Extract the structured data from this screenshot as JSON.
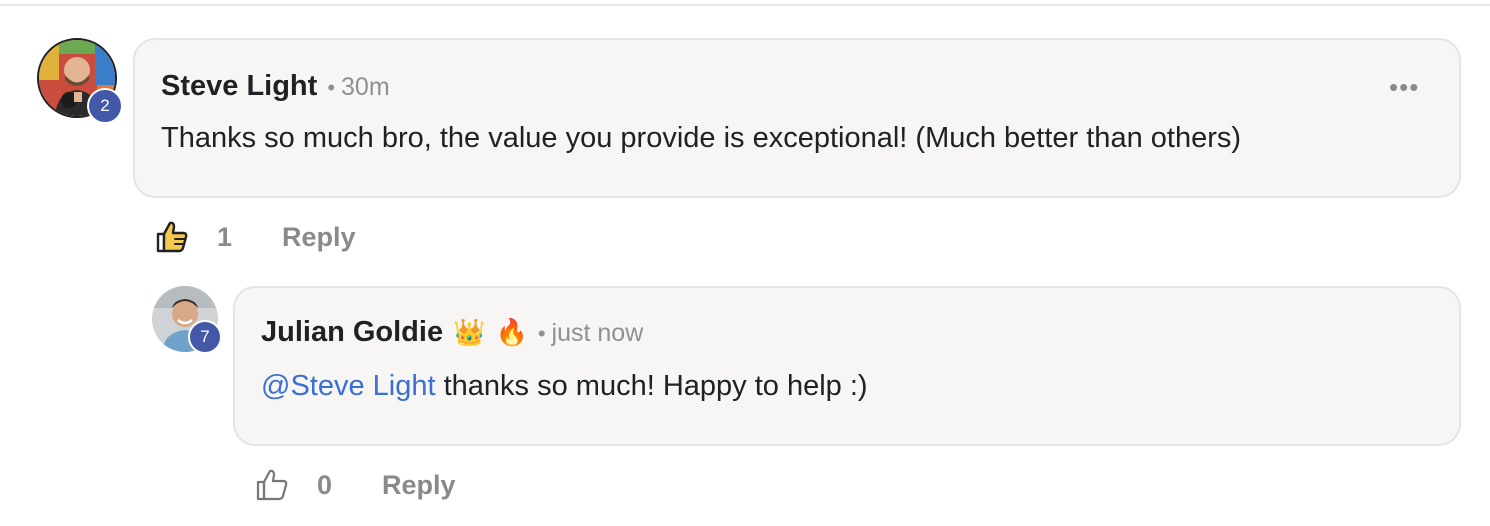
{
  "comments": [
    {
      "author": "Steve Light",
      "badges": [],
      "separator": "•",
      "time": "30m",
      "text": "Thanks so much bro, the value you provide is exceptional! (Much better than others)",
      "level": "2",
      "likes": "1",
      "liked": true,
      "reply_label": "Reply",
      "menu_label": "•••"
    },
    {
      "author": "Julian Goldie",
      "badges": [
        "👑",
        "🔥"
      ],
      "separator": "•",
      "time": "just now",
      "mention": "@Steve Light",
      "text": " thanks so much! Happy to help :)",
      "level": "7",
      "likes": "0",
      "liked": false,
      "reply_label": "Reply"
    }
  ],
  "colors": {
    "level_badge": "#4458a8",
    "liked_thumb_fill": "#f5c94c",
    "mention": "#3b6fd4",
    "bubble_bg": "#f7f6f5",
    "muted_text": "#8a8a8a"
  },
  "icons": {
    "like": "thumbs-up-icon",
    "menu": "more-horizontal-icon"
  }
}
